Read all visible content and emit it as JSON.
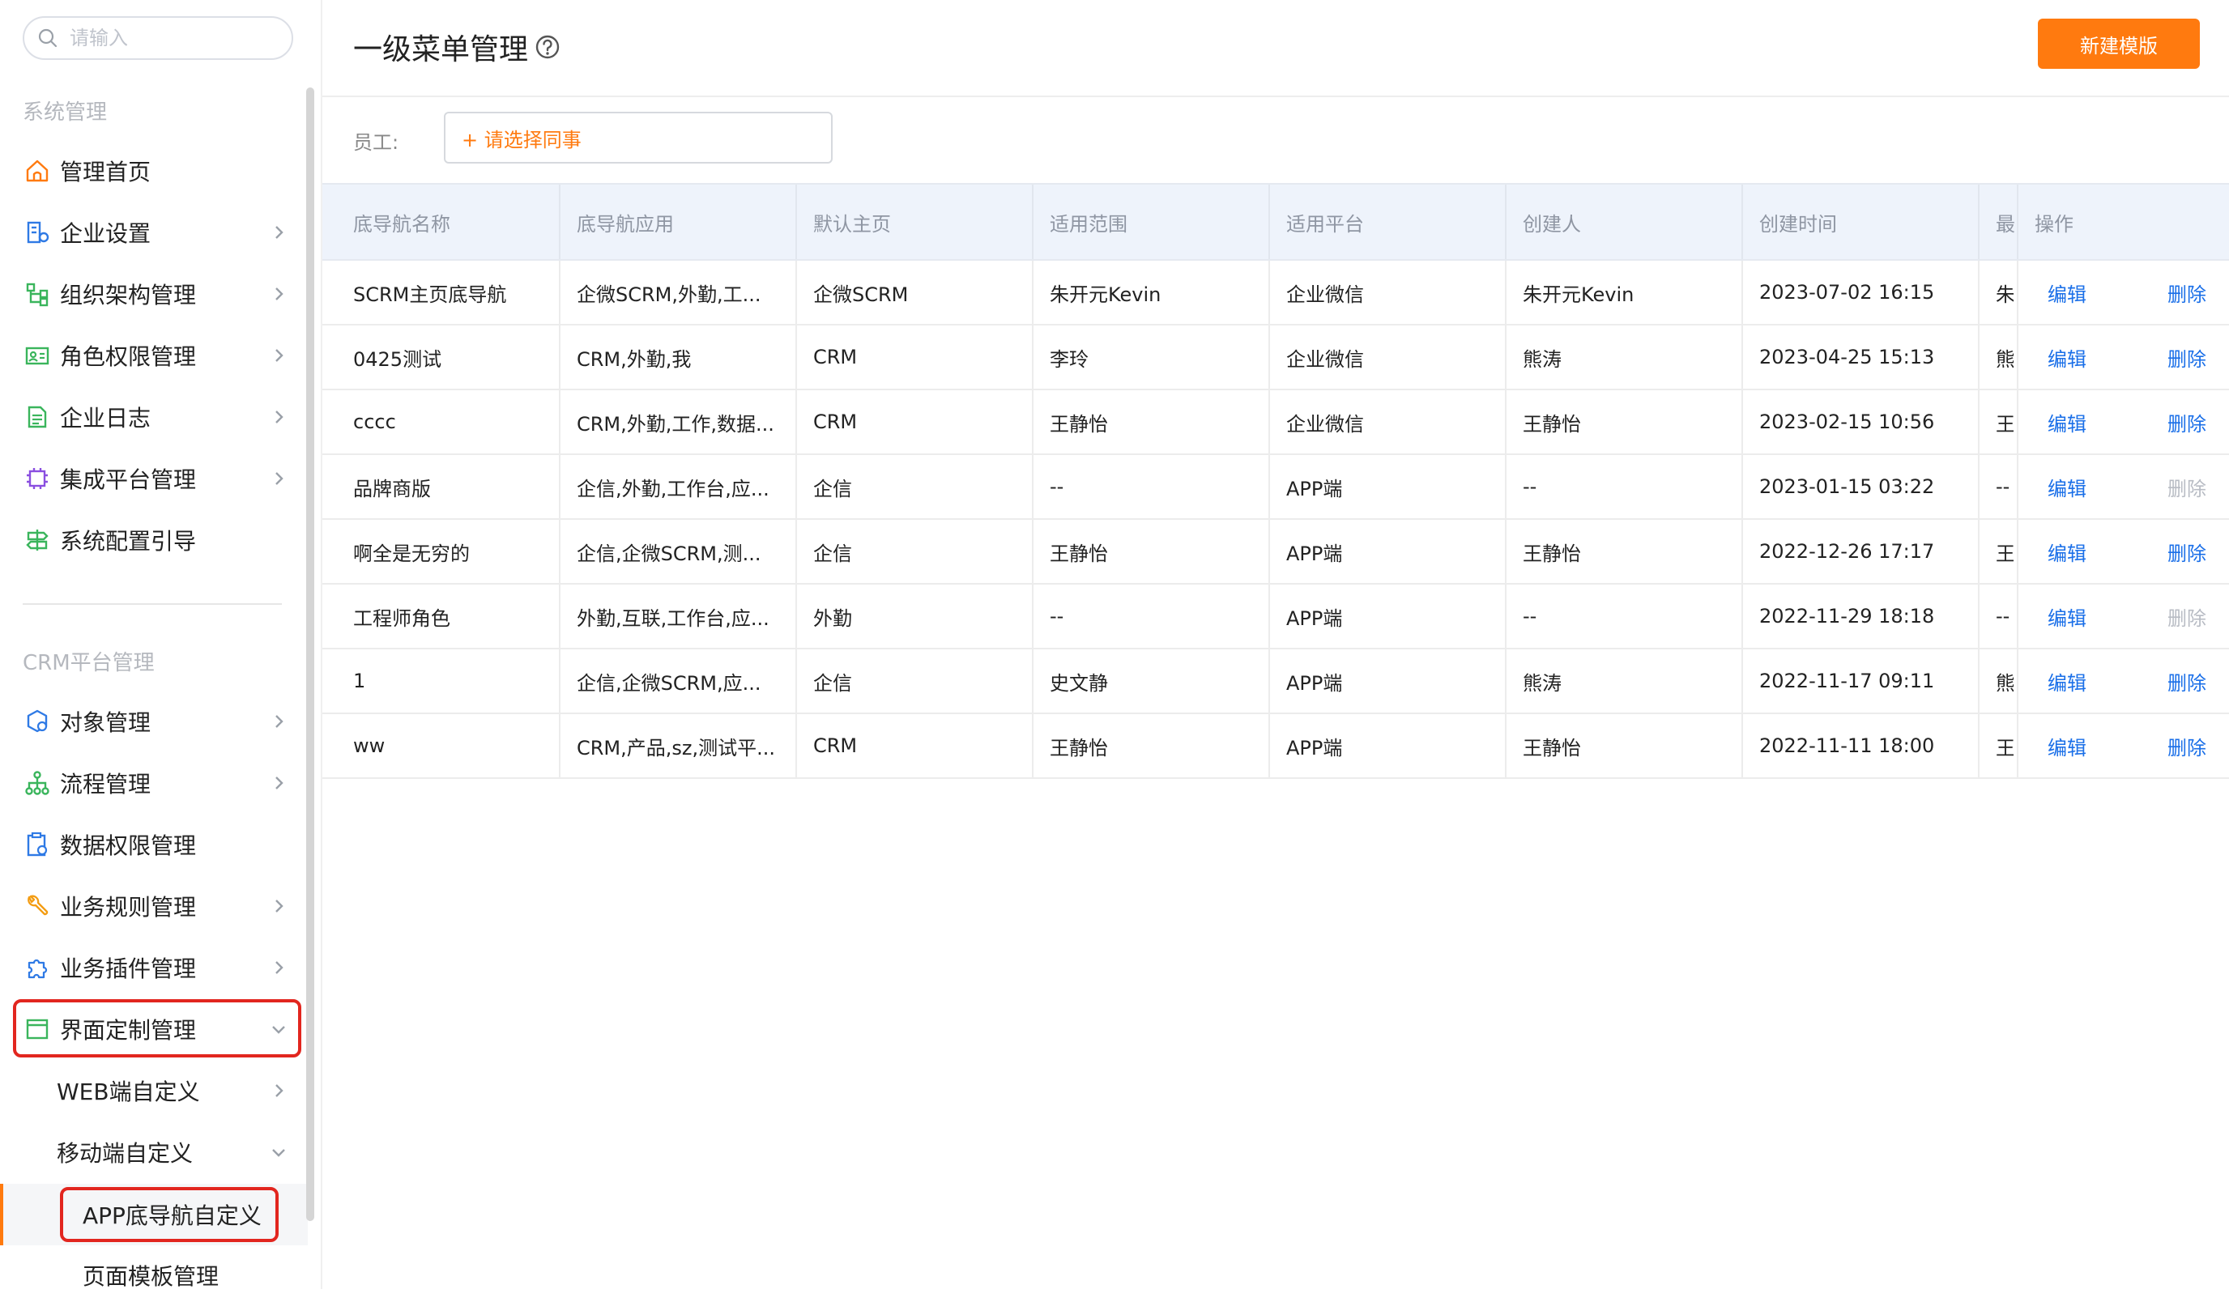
{
  "sidebar": {
    "search_placeholder": "请输入",
    "system_section": "系统管理",
    "system_items": [
      {
        "label": "管理首页"
      },
      {
        "label": "企业设置"
      },
      {
        "label": "组织架构管理"
      },
      {
        "label": "角色权限管理"
      },
      {
        "label": "企业日志"
      },
      {
        "label": "集成平台管理"
      },
      {
        "label": "系统配置引导"
      }
    ],
    "crm_section": "CRM平台管理",
    "crm_items": [
      {
        "label": "对象管理"
      },
      {
        "label": "流程管理"
      },
      {
        "label": "数据权限管理"
      },
      {
        "label": "业务规则管理"
      },
      {
        "label": "业务插件管理"
      },
      {
        "label": "界面定制管理"
      }
    ],
    "sub_items": [
      {
        "label": "WEB端自定义"
      },
      {
        "label": "移动端自定义"
      }
    ],
    "sub2_items": [
      {
        "label": "APP底导航自定义"
      },
      {
        "label": "页面模板管理"
      }
    ],
    "accent_color": "#ff7a0f"
  },
  "header": {
    "title": "一级菜单管理",
    "new_button": "新建模版"
  },
  "filter": {
    "label": "员工:",
    "picker": "+ 请选择同事"
  },
  "table": {
    "columns": [
      "底导航名称",
      "底导航应用",
      "默认主页",
      "适用范围",
      "适用平台",
      "创建人",
      "创建时间",
      "最",
      "操作"
    ],
    "edit_label": "编辑",
    "delete_label": "删除",
    "rows": [
      {
        "name": "SCRM主页底导航",
        "apps": "企微SCRM,外勤,工...",
        "home": "企微SCRM",
        "scope": "朱开元Kevin",
        "platform": "企业微信",
        "creator": "朱开元Kevin",
        "created": "2023-07-02 16:15",
        "last": "朱",
        "delete_enabled": true
      },
      {
        "name": "0425测试",
        "apps": "CRM,外勤,我",
        "home": "CRM",
        "scope": "李玲",
        "platform": "企业微信",
        "creator": "熊涛",
        "created": "2023-04-25 15:13",
        "last": "熊",
        "delete_enabled": true
      },
      {
        "name": "cccc",
        "apps": "CRM,外勤,工作,数据...",
        "home": "CRM",
        "scope": "王静怡",
        "platform": "企业微信",
        "creator": "王静怡",
        "created": "2023-02-15 10:56",
        "last": "王",
        "delete_enabled": true
      },
      {
        "name": "品牌商版",
        "apps": "企信,外勤,工作台,应...",
        "home": "企信",
        "scope": "--",
        "platform": "APP端",
        "creator": "--",
        "created": "2023-01-15 03:22",
        "last": "--",
        "delete_enabled": false
      },
      {
        "name": "啊全是无穷的",
        "apps": "企信,企微SCRM,测...",
        "home": "企信",
        "scope": "王静怡",
        "platform": "APP端",
        "creator": "王静怡",
        "created": "2022-12-26 17:17",
        "last": "王",
        "delete_enabled": true
      },
      {
        "name": "工程师角色",
        "apps": "外勤,互联,工作台,应...",
        "home": "外勤",
        "scope": "--",
        "platform": "APP端",
        "creator": "--",
        "created": "2022-11-29 18:18",
        "last": "--",
        "delete_enabled": false
      },
      {
        "name": "1",
        "apps": "企信,企微SCRM,应...",
        "home": "企信",
        "scope": "史文静",
        "platform": "APP端",
        "creator": "熊涛",
        "created": "2022-11-17 09:11",
        "last": "熊",
        "delete_enabled": true
      },
      {
        "name": "ww",
        "apps": "CRM,产品,sz,测试平...",
        "home": "CRM",
        "scope": "王静怡",
        "platform": "APP端",
        "creator": "王静怡",
        "created": "2022-11-11 18:00",
        "last": "王",
        "delete_enabled": true
      }
    ]
  }
}
